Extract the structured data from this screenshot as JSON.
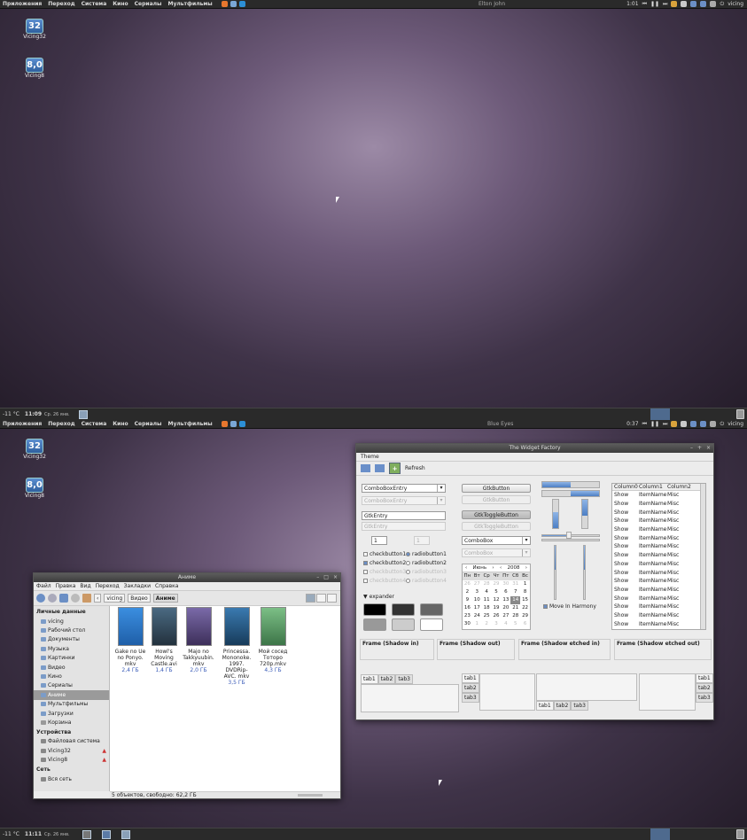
{
  "panels": {
    "menu": [
      "Приложения",
      "Переход",
      "Система",
      "Кино",
      "Сериалы",
      "Мультфильмы"
    ],
    "user": "vicing",
    "weather": "-11 °C",
    "date": "Ср. 26 янв."
  },
  "screen1": {
    "song": "Elton John",
    "clock": "1:01",
    "time": "11:09"
  },
  "screen2": {
    "song": "Blue Eyes",
    "clock": "0:37",
    "time": "11:11"
  },
  "desktop_icons": [
    {
      "badge": "32",
      "label": "Vicing32"
    },
    {
      "badge": "8,0",
      "label": "Vicing8"
    }
  ],
  "file_manager": {
    "title": "Аниме",
    "menu": [
      "Файл",
      "Правка",
      "Вид",
      "Переход",
      "Закладки",
      "Справка"
    ],
    "breadcrumbs": [
      "vicing",
      "Видео",
      "Аниме"
    ],
    "sidebar": {
      "personal_title": "Личные данные",
      "personal": [
        "vicing",
        "Рабочий стол",
        "Документы",
        "Музыка",
        "Картинки",
        "Видео",
        "Кино",
        "Сериалы",
        "Аниме",
        "Мультфильмы",
        "Загрузки",
        "Корзина"
      ],
      "devices_title": "Устройства",
      "devices": [
        "Файловая система",
        "Vicing32",
        "Vicing8"
      ],
      "network_title": "Сеть",
      "network": [
        "Вся сеть"
      ]
    },
    "files": [
      {
        "name": "Gake no Ue no Ponyo. mkv",
        "size": "2,4 ГБ",
        "color": "#2f7bd0"
      },
      {
        "name": "Howl's Moving Castle.avi",
        "size": "1,4 ГБ",
        "color": "#3a4d5c"
      },
      {
        "name": "Majo no Takkyuubin. mkv",
        "size": "2,0 ГБ",
        "color": "#5b4a7a"
      },
      {
        "name": "Princessa. Mononoke. 1997. DVDRip-AVC. mkv",
        "size": "3,5 ГБ",
        "color": "#2c5a7e"
      },
      {
        "name": "Мой сосед Тоторо 720p.mkv",
        "size": "4,3 ГБ",
        "color": "#5d9a64"
      }
    ],
    "status": "5 объектов, свободно: 62,2 ГБ"
  },
  "widget_factory": {
    "title": "The Widget Factory",
    "menu": "Theme",
    "refresh": "Refresh",
    "combo_entry": "ComboBoxEntry",
    "combo_entry_dis": "ComboBoxEntry",
    "entry": "GtkEntry",
    "entry_dis": "GtkEntry",
    "spin": "1",
    "spin_dis": "1",
    "button": "GtkButton",
    "button_dis": "GtkButton",
    "toggle": "GtkToggleButton",
    "toggle_dis": "GtkToggleButton",
    "combo": "ComboBox",
    "combo_dis": "ComboBox",
    "checks": [
      "checkbutton1",
      "checkbutton2",
      "checkbutton3",
      "checkbutton4"
    ],
    "radios": [
      "radiobutton1",
      "radiobutton2",
      "radiobutton3",
      "radiobutton4"
    ],
    "expander": "expander",
    "move_in_harmony": "Move In Harmony",
    "calendar": {
      "month": "Июнь",
      "year": "2008",
      "weekdays": [
        "Пн",
        "Вт",
        "Ср",
        "Чт",
        "Пт",
        "Сб",
        "Вс"
      ],
      "days": [
        "26",
        "27",
        "28",
        "29",
        "30",
        "31",
        "1",
        "2",
        "3",
        "4",
        "5",
        "6",
        "7",
        "8",
        "9",
        "10",
        "11",
        "12",
        "13",
        "14",
        "15",
        "16",
        "17",
        "18",
        "19",
        "20",
        "21",
        "22",
        "23",
        "24",
        "25",
        "26",
        "27",
        "28",
        "29",
        "30",
        "1",
        "2",
        "3",
        "4",
        "5",
        "6"
      ]
    },
    "tree": {
      "columns": [
        "Column0",
        "Column1",
        "Column2"
      ],
      "row": [
        "Show",
        "ItemName",
        "Misc"
      ],
      "rows": 16
    },
    "frames": [
      "Frame (Shadow in)",
      "Frame (Shadow out)",
      "Frame (Shadow etched in)",
      "Frame (Shadow etched out)"
    ],
    "tabs": [
      "tab1",
      "tab2",
      "tab3"
    ]
  }
}
